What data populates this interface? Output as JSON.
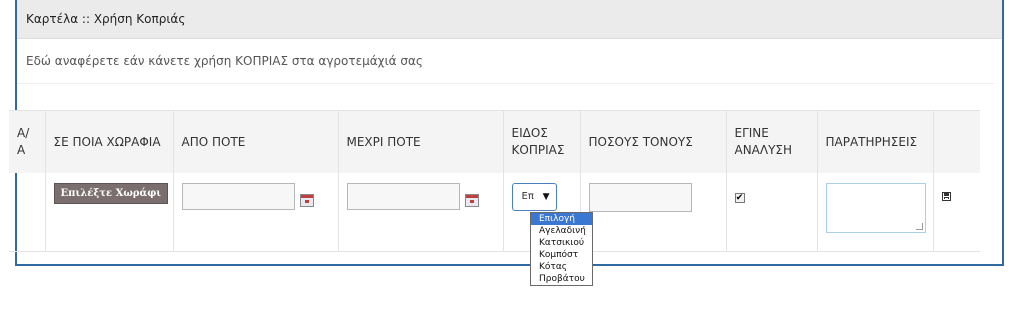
{
  "panel": {
    "title": "Καρτέλα :: Χρήση Κοπριάς",
    "intro": "Εδώ αναφέρετε εάν κάνετε χρήση ΚΟΠΡΙΑΣ στα αγροτεμάχιά σας"
  },
  "table": {
    "headers": {
      "aa": "Α/Α",
      "field": "ΣΕ ΠΟΙΑ ΧΩΡΑΦΙΑ",
      "from": "ΑΠΟ ΠΟΤΕ",
      "to": "ΜΕΧΡΙ ΠΟΤΕ",
      "type": "ΕΙΔΟΣ ΚΟΠΡΙΑΣ",
      "tons": "ΠΟΣΟΥΣ ΤΟΝΟΥΣ",
      "analysis": "ΕΓΙΝΕ ΑΝΑΛΥΣΗ",
      "notes": "ΠΑΡΑΤΗΡΗΣΕΙΣ"
    },
    "row": {
      "field_button": "Επιλέξτε Χωράφι",
      "from_value": "",
      "to_value": "",
      "type_selected": "Επ",
      "tons_value": "",
      "analysis_checked": "✔",
      "notes_value": ""
    }
  },
  "dropdown": {
    "options": [
      "Επιλογή",
      "Αγελαδινή",
      "Κατσικιού",
      "Κομπόστ",
      "Κότας",
      "Προβάτου"
    ]
  },
  "colors": {
    "panel_border": "#2f6aa3",
    "selected_option": "#3a77d3",
    "button_bg": "#7a6e6e"
  },
  "icons": {
    "calendar": "calendar-icon",
    "save": "save-icon",
    "dropdown_arrow": "caret-down-icon"
  }
}
